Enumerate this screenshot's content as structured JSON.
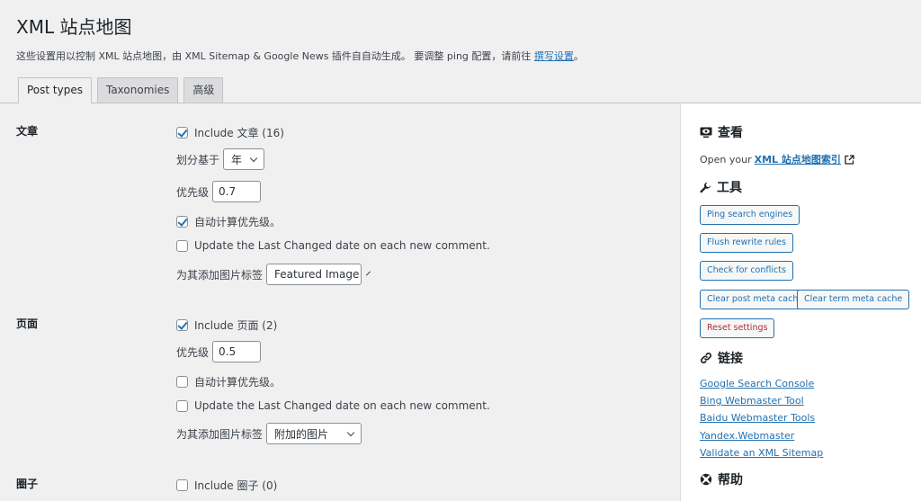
{
  "page": {
    "title": "XML 站点地图",
    "description_prefix": "这些设置用以控制 XML 站点地图，由 XML Sitemap & Google News 插件自自动生成。 要调整 ping 配置，请前往",
    "description_link": "撰写设置",
    "description_suffix": "。"
  },
  "tabs": [
    {
      "label": "Post types",
      "active": true
    },
    {
      "label": "Taxonomies",
      "active": false
    },
    {
      "label": "高级",
      "active": false
    }
  ],
  "sections": {
    "post": {
      "label": "文章",
      "include_label": "Include 文章 (16)",
      "include_checked": true,
      "split_label": "划分基于",
      "split_value": "年",
      "priority_label": "优先级",
      "priority_value": "0.7",
      "auto_priority_label": "自动计算优先级。",
      "auto_priority_checked": true,
      "update_label": "Update the Last Changed date on each new comment.",
      "update_checked": false,
      "image_tag_label": "为其添加图片标签",
      "image_tag_value": "Featured Image"
    },
    "page": {
      "label": "页面",
      "include_label": "Include 页面 (2)",
      "include_checked": true,
      "priority_label": "优先级",
      "priority_value": "0.5",
      "auto_priority_label": "自动计算优先级。",
      "auto_priority_checked": false,
      "update_label": "Update the Last Changed date on each new comment.",
      "update_checked": false,
      "image_tag_label": "为其添加图片标签",
      "image_tag_value": "附加的图片"
    },
    "circle": {
      "label": "圈子",
      "include_label": "Include 圈子 (0)",
      "include_checked": false
    }
  },
  "sidebar": {
    "view": {
      "heading": "查看",
      "text": "Open your",
      "link": "XML 站点地图索引"
    },
    "tools": {
      "heading": "工具",
      "ping": "Ping search engines",
      "flush": "Flush rewrite rules",
      "conflicts": "Check for conflicts",
      "clear_post": "Clear post meta caches",
      "clear_term": "Clear term meta cache",
      "reset": "Reset settings"
    },
    "links": {
      "heading": "链接",
      "items": [
        "Google Search Console",
        "Bing Webmaster Tool",
        "Baidu Webmaster Tools",
        "Yandex.Webmaster",
        "Validate an XML Sitemap"
      ]
    },
    "help": {
      "heading": "帮助"
    }
  },
  "colors": {
    "accent": "#2271b1",
    "danger": "#b32d2e",
    "background": "#f0f0f1"
  }
}
